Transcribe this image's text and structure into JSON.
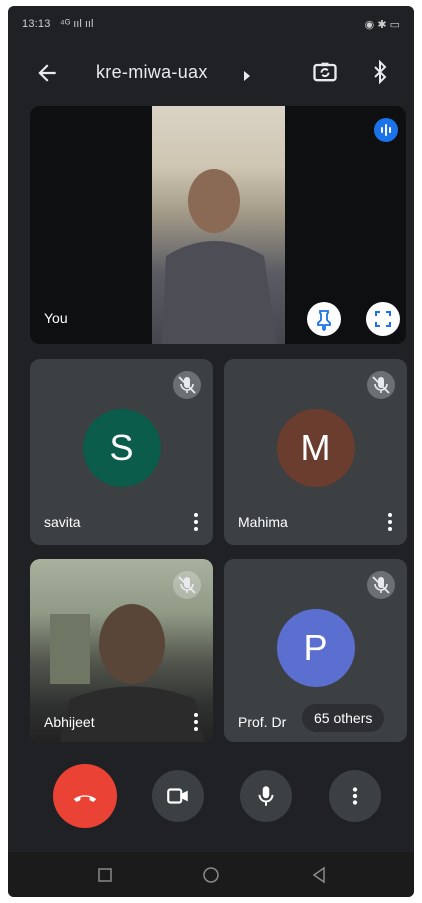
{
  "status_bar": {
    "time": "13:13",
    "signal_text": "⁴ᴳ ııl ııl",
    "right_text": "◉ ✱ ▭"
  },
  "header": {
    "meeting_code": "kre-miwa-uax"
  },
  "self_tile": {
    "label": "You"
  },
  "participants": [
    {
      "name": "savita",
      "initial": "S",
      "avatar_color": "#0b5c4a"
    },
    {
      "name": "Mahima",
      "initial": "M",
      "avatar_color": "#6b3d2e"
    },
    {
      "name": "Abhijeet"
    },
    {
      "name": "Prof. Dr",
      "initial": "P",
      "avatar_color": "#5b6fd0"
    }
  ],
  "others_badge": "65 others",
  "colors": {
    "background": "#202124",
    "tile": "#3c4043",
    "hangup": "#ea4335",
    "speaking_badge": "#1a73e8"
  },
  "icons": {
    "back": "arrow-left-icon",
    "switch_camera": "switch-camera-icon",
    "bluetooth": "bluetooth-icon",
    "speaking": "audio-level-icon",
    "pin": "pin-icon",
    "fullscreen": "fullscreen-icon",
    "muted": "mic-off-icon",
    "more": "more-vertical-icon",
    "hangup": "call-end-icon",
    "camera": "videocam-icon",
    "mic": "mic-icon",
    "options": "more-vertical-icon"
  }
}
